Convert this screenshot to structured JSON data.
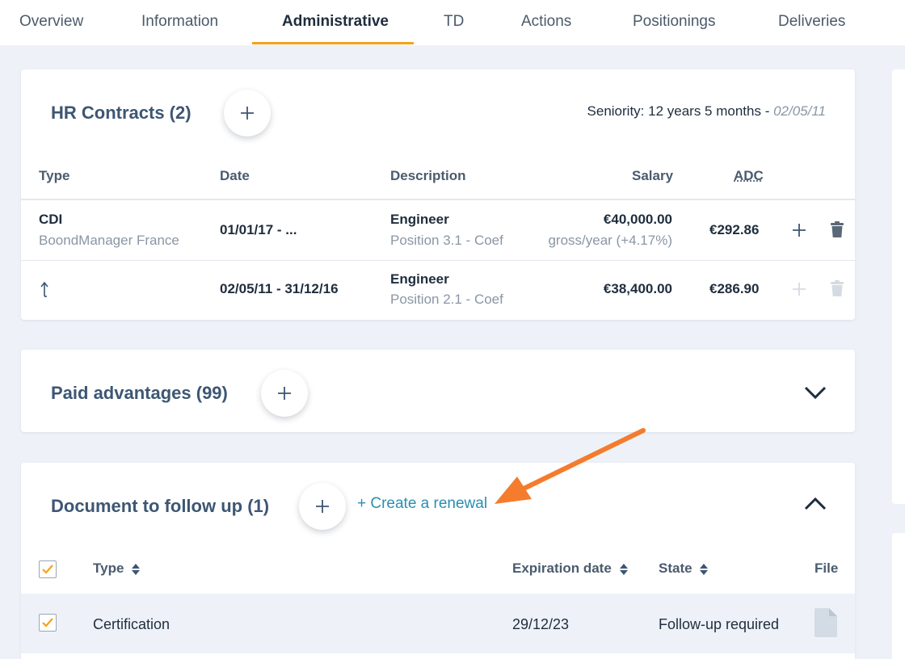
{
  "tabs": [
    {
      "label": "Overview"
    },
    {
      "label": "Information"
    },
    {
      "label": "Administrative"
    },
    {
      "label": "TD"
    },
    {
      "label": "Actions"
    },
    {
      "label": "Positionings"
    },
    {
      "label": "Deliveries"
    }
  ],
  "hr": {
    "title": "HR Contracts (2)",
    "seniority_label": "Seniority: 12 years 5 months - ",
    "seniority_date": "02/05/11",
    "columns": {
      "type": "Type",
      "date": "Date",
      "description": "Description",
      "salary": "Salary",
      "adc": "ADC"
    },
    "rows": [
      {
        "type": "CDI",
        "company": "BoondManager France",
        "date": "01/01/17 - ...",
        "title": "Engineer",
        "position": "Position 3.1 - Coef",
        "salary": "€40,000.00",
        "salary_sub": "gross/year (+4.17%)",
        "adc": "€292.86"
      },
      {
        "type_icon": "history-arrow-icon",
        "date": "02/05/11 - 31/12/16",
        "title": "Engineer",
        "position": "Position 2.1 - Coef",
        "salary": "€38,400.00",
        "adc": "€286.90"
      }
    ]
  },
  "advantages": {
    "title": "Paid advantages (99)"
  },
  "documents": {
    "title": "Document to follow up (1)",
    "renewal_label": "+ Create a renewal",
    "columns": {
      "type": "Type",
      "expiration": "Expiration date",
      "state": "State",
      "file": "File"
    },
    "rows": [
      {
        "type": "Certification",
        "expiration": "29/12/23",
        "state": "Follow-up required",
        "checked": true
      }
    ]
  },
  "colors": {
    "accent": "#f5a21a",
    "title": "#3d5673",
    "link": "#2b8eb0",
    "arrow": "#f47c2c"
  }
}
